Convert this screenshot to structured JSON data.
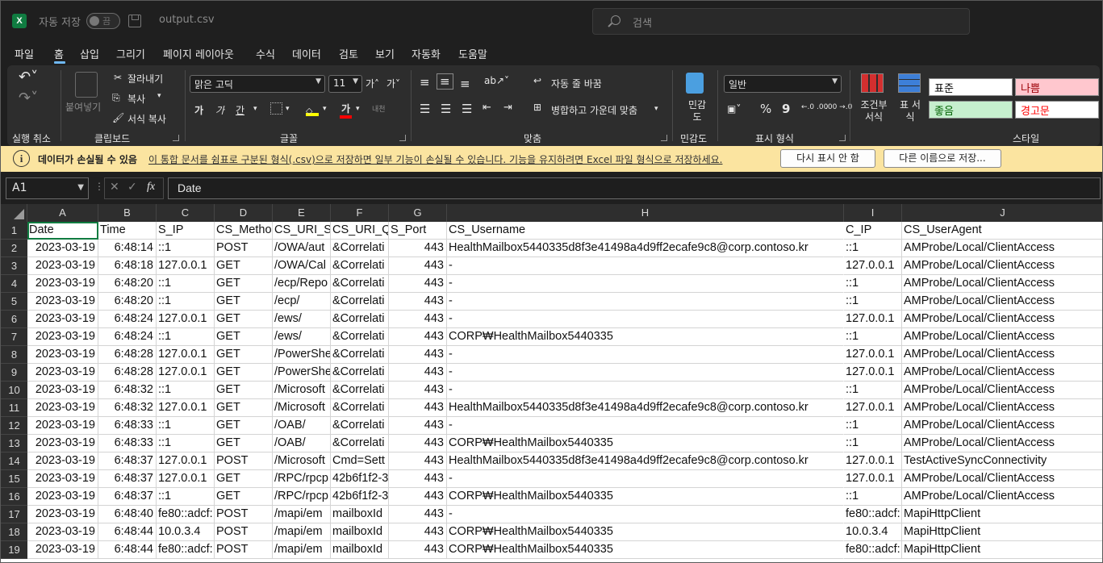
{
  "title_bar": {
    "autosave_label": "자동 저장",
    "autosave_state": "끔",
    "filename": "output.csv",
    "search_placeholder": "검색"
  },
  "menu": [
    "파일",
    "홈",
    "삽입",
    "그리기",
    "페이지 레이아웃",
    "수식",
    "데이터",
    "검토",
    "보기",
    "자동화",
    "도움말"
  ],
  "active_menu": "홈",
  "ribbon": {
    "undo_group": "실행 취소",
    "clipboard": {
      "paste": "붙여넣기",
      "cut": "잘라내기",
      "copy": "복사",
      "format_painter": "서식 복사",
      "label": "클립보드"
    },
    "font": {
      "name": "맑은 고딕",
      "size": "11",
      "grow": "가˄",
      "shrink": "가˅",
      "bold": "가",
      "italic": "가",
      "underline": "간",
      "color_a": "가",
      "phonetic": "내천",
      "label": "글꼴"
    },
    "alignment": {
      "wrap": "자동 줄 바꿈",
      "merge": "병합하고 가운데 맞춤",
      "label": "맞춤"
    },
    "sensitivity": {
      "button": "민감도",
      "label": "민감도"
    },
    "number": {
      "format": "일반",
      "percent": "%",
      "comma": "9",
      "inc": "←.0 .00",
      "dec": ".00 →.0",
      "label": "표시 형식"
    },
    "styles": {
      "conditional": "조건부 서식",
      "table": "표 서식",
      "normal": "표준",
      "bad": "나쁨",
      "good": "좋음",
      "warning": "경고문",
      "label": "스타일"
    }
  },
  "infobar": {
    "bold": "데이터가 손실될 수 있음",
    "text": "이 통합 문서를 쉼표로 구분된 형식(.csv)으로 저장하면 일부 기능이 손실될 수 있습니다. 기능을 유지하려면 Excel 파일 형식으로 저장하세요.",
    "button_dismiss": "다시 표시 안 함",
    "button_saveas": "다른 이름으로 저장..."
  },
  "formula_bar": {
    "name_box": "A1",
    "fx": "fx",
    "value": "Date"
  },
  "colors": {
    "accent": "#107c41",
    "infobar_bg": "#fbe4a0",
    "bad_bg": "#ffc7ce",
    "good_bg": "#c6efce"
  },
  "sheet": {
    "columns": [
      "A",
      "B",
      "C",
      "D",
      "E",
      "F",
      "G",
      "H",
      "I",
      "J"
    ],
    "rows": [
      [
        "Date",
        "Time",
        "S_IP",
        "CS_Metho",
        "CS_URI_St",
        "CS_URI_Qu",
        "S_Port",
        "CS_Username",
        "C_IP",
        "CS_UserAgent"
      ],
      [
        "2023-03-19",
        "6:48:14",
        "::1",
        "POST",
        "/OWA/aut",
        "&Correlati",
        "443",
        "HealthMailbox5440335d8f3e41498a4d9ff2ecafe9c8@corp.contoso.kr",
        "::1",
        "AMProbe/Local/ClientAccess"
      ],
      [
        "2023-03-19",
        "6:48:18",
        "127.0.0.1",
        "GET",
        "/OWA/Cal",
        "&Correlati",
        "443",
        "-",
        "127.0.0.1",
        "AMProbe/Local/ClientAccess"
      ],
      [
        "2023-03-19",
        "6:48:20",
        "::1",
        "GET",
        "/ecp/Repo",
        "&Correlati",
        "443",
        "-",
        "::1",
        "AMProbe/Local/ClientAccess"
      ],
      [
        "2023-03-19",
        "6:48:20",
        "::1",
        "GET",
        "/ecp/",
        "&Correlati",
        "443",
        "-",
        "::1",
        "AMProbe/Local/ClientAccess"
      ],
      [
        "2023-03-19",
        "6:48:24",
        "127.0.0.1",
        "GET",
        "/ews/",
        "&Correlati",
        "443",
        "-",
        "127.0.0.1",
        "AMProbe/Local/ClientAccess"
      ],
      [
        "2023-03-19",
        "6:48:24",
        "::1",
        "GET",
        "/ews/",
        "&Correlati",
        "443",
        "CORP₩HealthMailbox5440335",
        "::1",
        "AMProbe/Local/ClientAccess"
      ],
      [
        "2023-03-19",
        "6:48:28",
        "127.0.0.1",
        "GET",
        "/PowerShe",
        "&Correlati",
        "443",
        "-",
        "127.0.0.1",
        "AMProbe/Local/ClientAccess"
      ],
      [
        "2023-03-19",
        "6:48:28",
        "127.0.0.1",
        "GET",
        "/PowerShe",
        "&Correlati",
        "443",
        "-",
        "127.0.0.1",
        "AMProbe/Local/ClientAccess"
      ],
      [
        "2023-03-19",
        "6:48:32",
        "::1",
        "GET",
        "/Microsoft",
        "&Correlati",
        "443",
        "-",
        "::1",
        "AMProbe/Local/ClientAccess"
      ],
      [
        "2023-03-19",
        "6:48:32",
        "127.0.0.1",
        "GET",
        "/Microsoft",
        "&Correlati",
        "443",
        "HealthMailbox5440335d8f3e41498a4d9ff2ecafe9c8@corp.contoso.kr",
        "127.0.0.1",
        "AMProbe/Local/ClientAccess"
      ],
      [
        "2023-03-19",
        "6:48:33",
        "::1",
        "GET",
        "/OAB/",
        "&Correlati",
        "443",
        "-",
        "::1",
        "AMProbe/Local/ClientAccess"
      ],
      [
        "2023-03-19",
        "6:48:33",
        "::1",
        "GET",
        "/OAB/",
        "&Correlati",
        "443",
        "CORP₩HealthMailbox5440335",
        "::1",
        "AMProbe/Local/ClientAccess"
      ],
      [
        "2023-03-19",
        "6:48:37",
        "127.0.0.1",
        "POST",
        "/Microsoft",
        "Cmd=Sett",
        "443",
        "HealthMailbox5440335d8f3e41498a4d9ff2ecafe9c8@corp.contoso.kr",
        "127.0.0.1",
        "TestActiveSyncConnectivity"
      ],
      [
        "2023-03-19",
        "6:48:37",
        "127.0.0.1",
        "GET",
        "/RPC/rpcp",
        "42b6f1f2-3",
        "443",
        "-",
        "127.0.0.1",
        "AMProbe/Local/ClientAccess"
      ],
      [
        "2023-03-19",
        "6:48:37",
        "::1",
        "GET",
        "/RPC/rpcp",
        "42b6f1f2-3",
        "443",
        "CORP₩HealthMailbox5440335",
        "::1",
        "AMProbe/Local/ClientAccess"
      ],
      [
        "2023-03-19",
        "6:48:40",
        "fe80::adcf:",
        "POST",
        "/mapi/em",
        "mailboxId",
        "443",
        "-",
        "fe80::adcf:",
        "MapiHttpClient"
      ],
      [
        "2023-03-19",
        "6:48:44",
        "10.0.3.4",
        "POST",
        "/mapi/em",
        "mailboxId",
        "443",
        "CORP₩HealthMailbox5440335",
        "10.0.3.4",
        "MapiHttpClient"
      ],
      [
        "2023-03-19",
        "6:48:44",
        "fe80::adcf:",
        "POST",
        "/mapi/em",
        "mailboxId",
        "443",
        "CORP₩HealthMailbox5440335",
        "fe80::adcf:",
        "MapiHttpClient"
      ]
    ]
  }
}
